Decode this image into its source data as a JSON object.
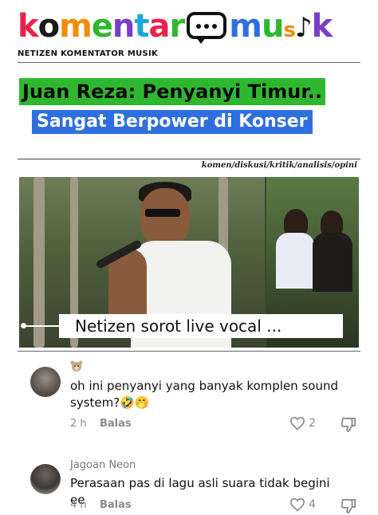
{
  "header": {
    "logo": {
      "part1": "komentar",
      "part2": "musik",
      "colors": [
        "#e8234a",
        "#1a1a1a",
        "#f28c00",
        "#2fb82f",
        "#7a3cc9",
        "#1ea7d9",
        "#e8234a",
        "#2e6fe0"
      ]
    },
    "tagline": "NETIZEN KOMENTATOR MUSIK"
  },
  "headline": {
    "line1": "Juan Reza: Penyanyi Timur..",
    "line2": "Sangat Berpower di Konser",
    "line1_bg": "#2fb82f",
    "line2_bg": "#2e6fe0"
  },
  "categories": "komen/diskusi/kritik/analisis/opini",
  "video": {
    "caption": "Netizen sorot live vocal ..."
  },
  "comments": [
    {
      "name": "",
      "name_icon": "bear-emoji-icon",
      "text": "oh ini penyanyi yang banyak komplen sound system?🤣🤭",
      "time": "2 h",
      "reply": "Balas",
      "likes": "2"
    },
    {
      "name": "Jagoan Neon",
      "text": "Perasaan pas di lagu asli suara tidak begini ee",
      "time": "4 h",
      "reply": "Balas",
      "likes": "4"
    }
  ]
}
